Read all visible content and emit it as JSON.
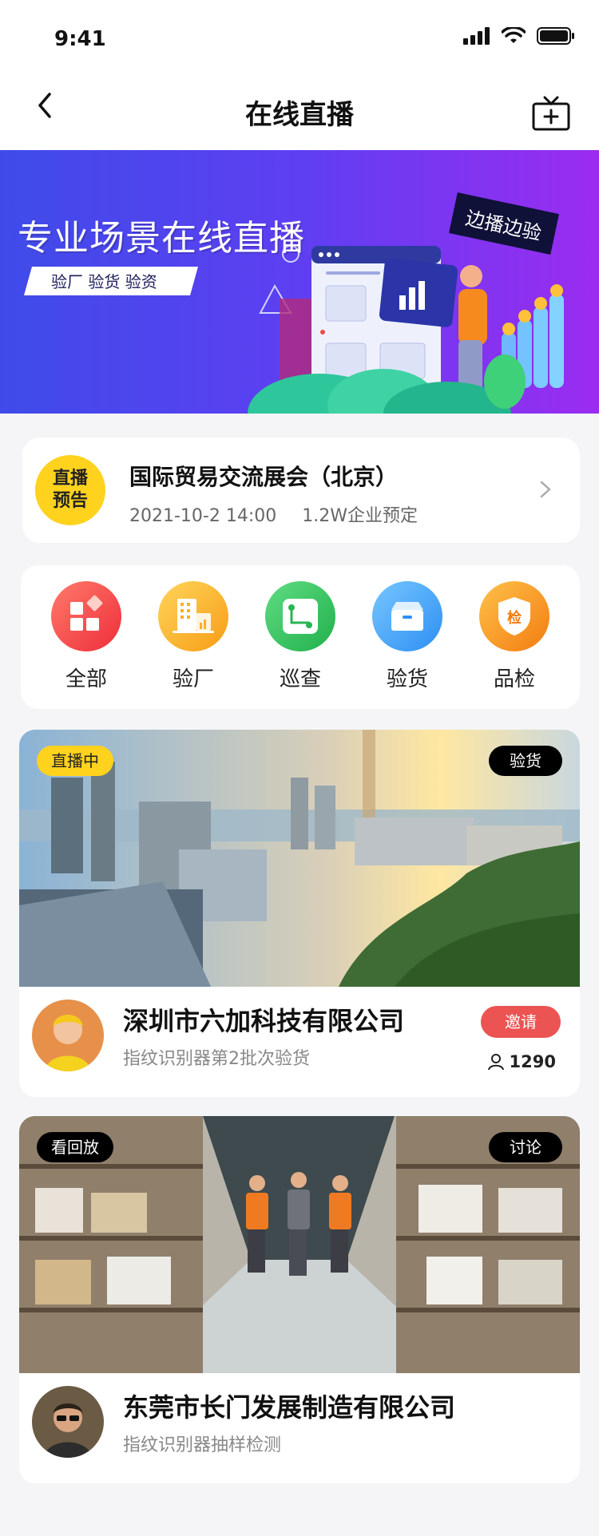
{
  "status_bar": {
    "time": "9:41"
  },
  "header": {
    "title": "在线直播"
  },
  "banner": {
    "title": "专业场景在线直播",
    "chip": "验厂 验货 验资",
    "badge": "边播边验"
  },
  "preview": {
    "badge_line1": "直播",
    "badge_line2": "预告",
    "title": "国际贸易交流展会（北京）",
    "datetime": "2021-10-2 14:00",
    "reservations": "1.2W企业预定"
  },
  "categories": [
    {
      "label": "全部",
      "icon": "grid-icon",
      "color": "#f24646"
    },
    {
      "label": "验厂",
      "icon": "factory-icon",
      "color": "#f9b11e"
    },
    {
      "label": "巡查",
      "icon": "route-icon",
      "color": "#31c05c"
    },
    {
      "label": "验货",
      "icon": "box-icon",
      "color": "#3d9ef5"
    },
    {
      "label": "品检",
      "icon": "inspect-shield-icon",
      "color": "#f59a16"
    }
  ],
  "streams": [
    {
      "status": "直播中",
      "category": "验货",
      "company": "深圳市六加科技有限公司",
      "subtitle": "指纹识别器第2批次验货",
      "action": "邀请",
      "viewers": "1290"
    },
    {
      "status": "看回放",
      "category": "讨论",
      "company": "东莞市长门发展制造有限公司",
      "subtitle": "指纹识别器抽样检测"
    }
  ],
  "colors": {
    "accent_yellow": "#ffd21e",
    "invite_red": "#ec5353",
    "banner_start": "#3f4be9",
    "banner_end": "#9b2cf0"
  }
}
